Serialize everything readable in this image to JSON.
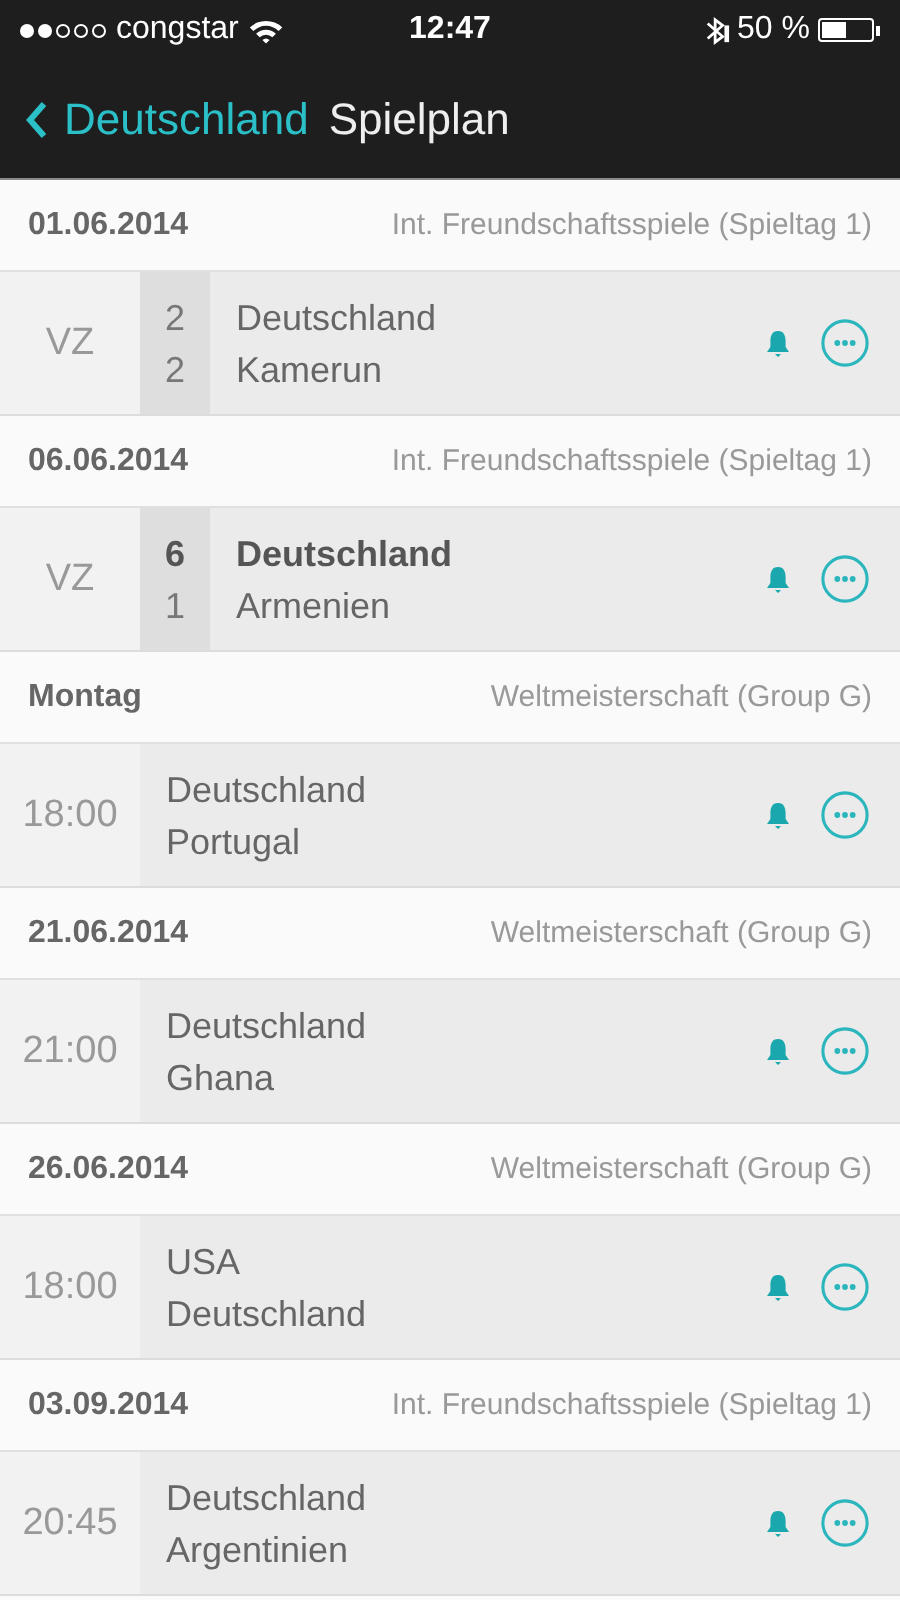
{
  "status_bar": {
    "carrier": "congstar",
    "time": "12:47",
    "battery_text": "50 %"
  },
  "nav": {
    "back": "Deutschland",
    "title": "Spielplan"
  },
  "days": [
    {
      "date": "01.06.2014",
      "competition": "Int. Freundschaftsspiele (Spieltag 1)",
      "match": {
        "kind": "result",
        "status": "VZ",
        "teams": [
          {
            "name": "Deutschland",
            "score": "2",
            "winner": false
          },
          {
            "name": "Kamerun",
            "score": "2",
            "winner": false
          }
        ]
      }
    },
    {
      "date": "06.06.2014",
      "competition": "Int. Freundschaftsspiele (Spieltag 1)",
      "match": {
        "kind": "result",
        "status": "VZ",
        "teams": [
          {
            "name": "Deutschland",
            "score": "6",
            "winner": true
          },
          {
            "name": "Armenien",
            "score": "1",
            "winner": false
          }
        ]
      }
    },
    {
      "date": "Montag",
      "competition": "Weltmeisterschaft (Group G)",
      "match": {
        "kind": "fixture",
        "time": "18:00",
        "teams": [
          {
            "name": "Deutschland"
          },
          {
            "name": "Portugal"
          }
        ]
      }
    },
    {
      "date": "21.06.2014",
      "competition": "Weltmeisterschaft (Group G)",
      "match": {
        "kind": "fixture",
        "time": "21:00",
        "teams": [
          {
            "name": "Deutschland"
          },
          {
            "name": "Ghana"
          }
        ]
      }
    },
    {
      "date": "26.06.2014",
      "competition": "Weltmeisterschaft (Group G)",
      "match": {
        "kind": "fixture",
        "time": "18:00",
        "teams": [
          {
            "name": "USA"
          },
          {
            "name": "Deutschland"
          }
        ]
      }
    },
    {
      "date": "03.09.2014",
      "competition": "Int. Freundschaftsspiele (Spieltag 1)",
      "match": {
        "kind": "fixture",
        "time": "20:45",
        "teams": [
          {
            "name": "Deutschland"
          },
          {
            "name": "Argentinien"
          }
        ]
      }
    }
  ]
}
